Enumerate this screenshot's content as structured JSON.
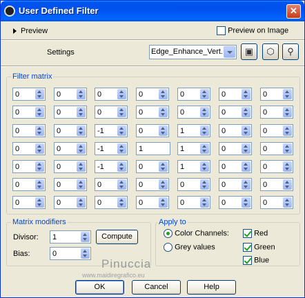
{
  "window": {
    "title": "User Defined Filter",
    "close_glyph": "✕"
  },
  "preview": {
    "label": "Preview",
    "preview_on_image_label": "Preview on Image",
    "preview_on_image_checked": false
  },
  "settings": {
    "label": "Settings",
    "preset_value": "Edge_Enhance_Vert..."
  },
  "toolbar": {
    "save_icon": "floppy-disk-icon",
    "load_icon": "cube-icon",
    "reset_icon": "magnifier-icon"
  },
  "filter_matrix": {
    "label": "Filter matrix",
    "rows": [
      [
        "0",
        "0",
        "0",
        "0",
        "0",
        "0",
        "0"
      ],
      [
        "0",
        "0",
        "0",
        "0",
        "0",
        "0",
        "0"
      ],
      [
        "0",
        "0",
        "-1",
        "0",
        "1",
        "0",
        "0"
      ],
      [
        "0",
        "0",
        "-1",
        "1",
        "1",
        "0",
        "0"
      ],
      [
        "0",
        "0",
        "-1",
        "0",
        "1",
        "0",
        "0"
      ],
      [
        "0",
        "0",
        "0",
        "0",
        "0",
        "0",
        "0"
      ],
      [
        "0",
        "0",
        "0",
        "0",
        "0",
        "0",
        "0"
      ]
    ]
  },
  "matrix_modifiers": {
    "label": "Matrix modifiers",
    "divisor_label": "Divisor:",
    "divisor_value": "1",
    "bias_label": "Bias:",
    "bias_value": "0",
    "compute_label": "Compute"
  },
  "apply_to": {
    "label": "Apply to",
    "color_channels_label": "Color Channels:",
    "grey_values_label": "Grey values",
    "selected_mode": "color_channels",
    "red_label": "Red",
    "green_label": "Green",
    "blue_label": "Blue",
    "red_checked": true,
    "green_checked": true,
    "blue_checked": true
  },
  "watermark": {
    "text": "Pinuccia",
    "url": "www.maidiregrafico.eu"
  },
  "buttons": {
    "ok": "OK",
    "cancel": "Cancel",
    "help": "Help"
  }
}
